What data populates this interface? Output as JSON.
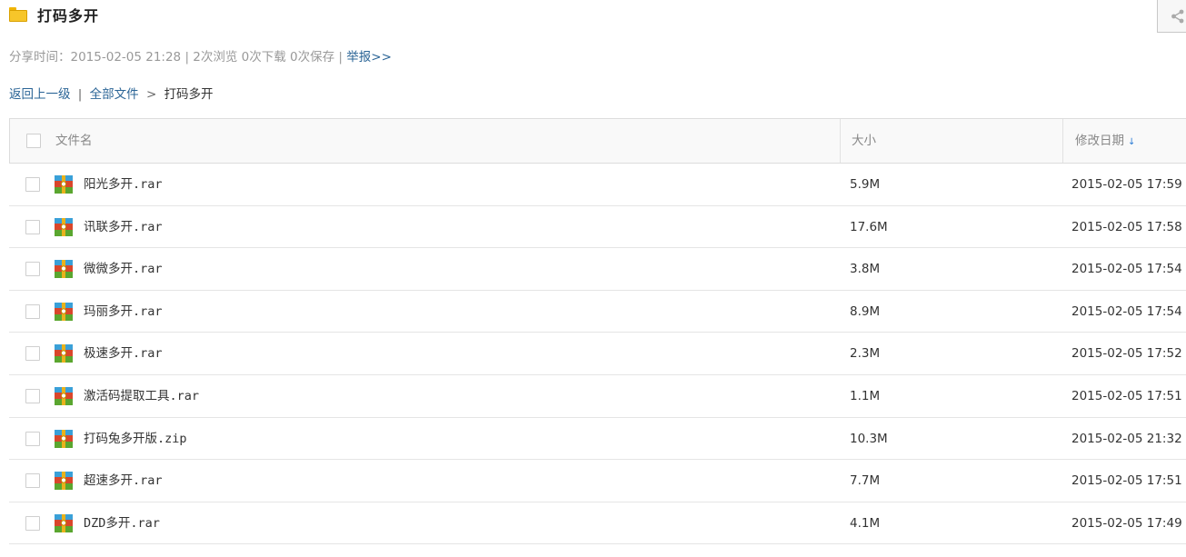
{
  "page": {
    "title": "打码多开",
    "share_icon": "share-icon"
  },
  "meta": {
    "share_time": "分享时间：2015-02-05 21:28 | 2次浏览 0次下载 0次保存 |",
    "report_link": "举报>>"
  },
  "breadcrumb": {
    "back": "返回上一级",
    "sep1": "|",
    "all_files": "全部文件",
    "sep2": ">",
    "current": "打码多开"
  },
  "table": {
    "headers": {
      "name": "文件名",
      "size": "大小",
      "date": "修改日期"
    },
    "sort_indicator": "↓",
    "rows": [
      {
        "name": "阳光多开.rar",
        "size": "5.9M",
        "date": "2015-02-05 17:59"
      },
      {
        "name": "讯联多开.rar",
        "size": "17.6M",
        "date": "2015-02-05 17:58"
      },
      {
        "name": "微微多开.rar",
        "size": "3.8M",
        "date": "2015-02-05 17:54"
      },
      {
        "name": "玛丽多开.rar",
        "size": "8.9M",
        "date": "2015-02-05 17:54"
      },
      {
        "name": "极速多开.rar",
        "size": "2.3M",
        "date": "2015-02-05 17:52"
      },
      {
        "name": "激活码提取工具.rar",
        "size": "1.1M",
        "date": "2015-02-05 17:51"
      },
      {
        "name": "打码兔多开版.zip",
        "size": "10.3M",
        "date": "2015-02-05 21:32"
      },
      {
        "name": "超速多开.rar",
        "size": "7.7M",
        "date": "2015-02-05 17:51"
      },
      {
        "name": "DZD多开.rar",
        "size": "4.1M",
        "date": "2015-02-05 17:49"
      }
    ]
  },
  "colors": {
    "link": "#2a6496",
    "muted": "#999999",
    "header_bg": "#f9f9f9",
    "sort_arrow": "#2a7bd4",
    "folder": "#f7c62a"
  }
}
